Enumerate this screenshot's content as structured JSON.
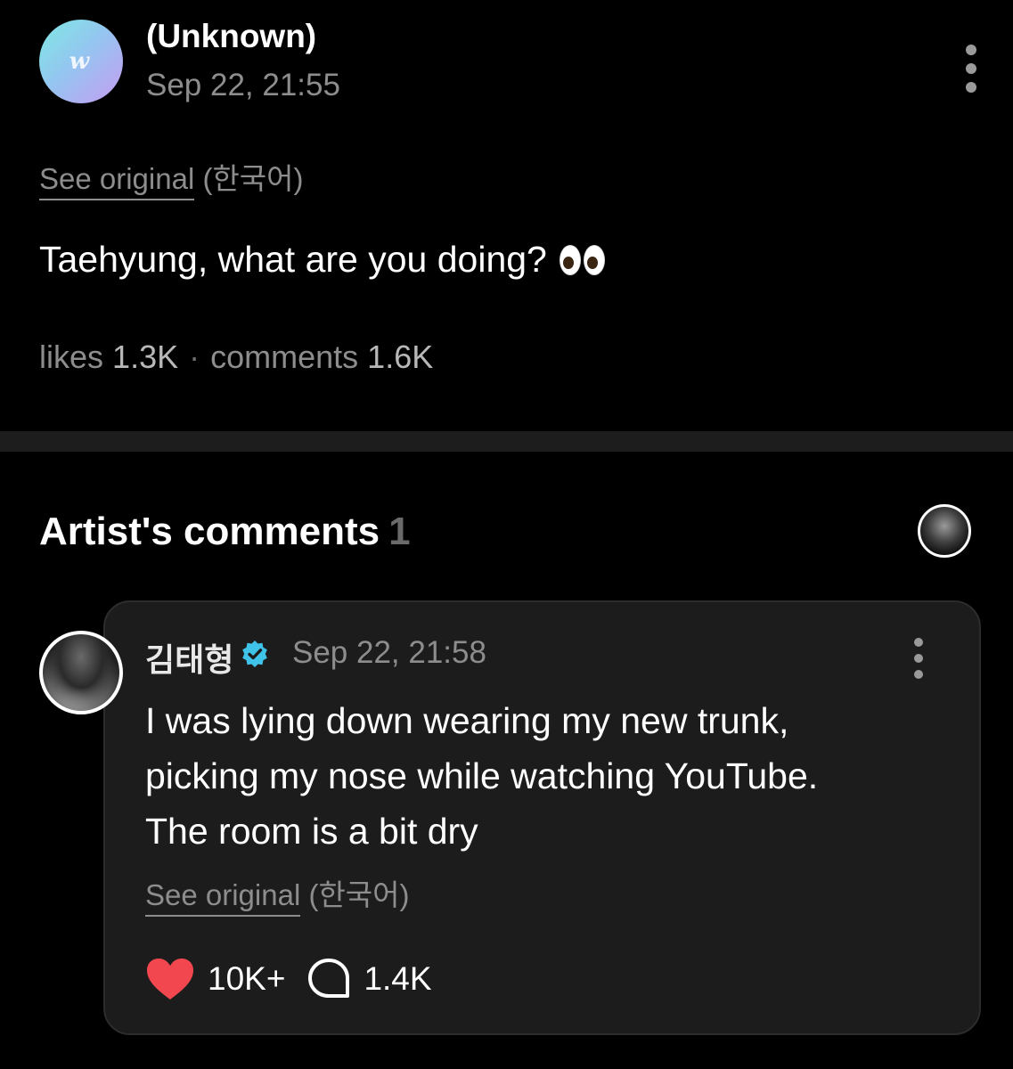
{
  "post": {
    "author": "(Unknown)",
    "time": "Sep 22, 21:55",
    "see_original": "See original",
    "language": "(한국어)",
    "text": "Taehyung, what are you doing?",
    "likes_label": "likes",
    "likes_value": "1.3K",
    "separator": "·",
    "comments_label": "comments",
    "comments_value": "1.6K"
  },
  "artist_comments": {
    "title": "Artist's comments",
    "count": "1"
  },
  "comment": {
    "author": "김태형",
    "time": "Sep 22, 21:58",
    "lines": [
      "I was lying down wearing my new trunk,",
      "picking my nose while watching YouTube.",
      "The room is a bit dry"
    ],
    "see_original": "See original",
    "language": "(한국어)",
    "likes": "10K+",
    "replies": "1.4K"
  },
  "colors": {
    "background": "#000000",
    "card": "#1c1c1c",
    "muted_text": "#8d8d8d",
    "heart": "#f2474f",
    "verified": "#3fc3e8"
  },
  "icons": [
    "weverse-logo-icon",
    "more-vertical-icon",
    "eyes-emoji-icon",
    "verified-badge-icon",
    "heart-icon",
    "comment-bubble-icon"
  ]
}
